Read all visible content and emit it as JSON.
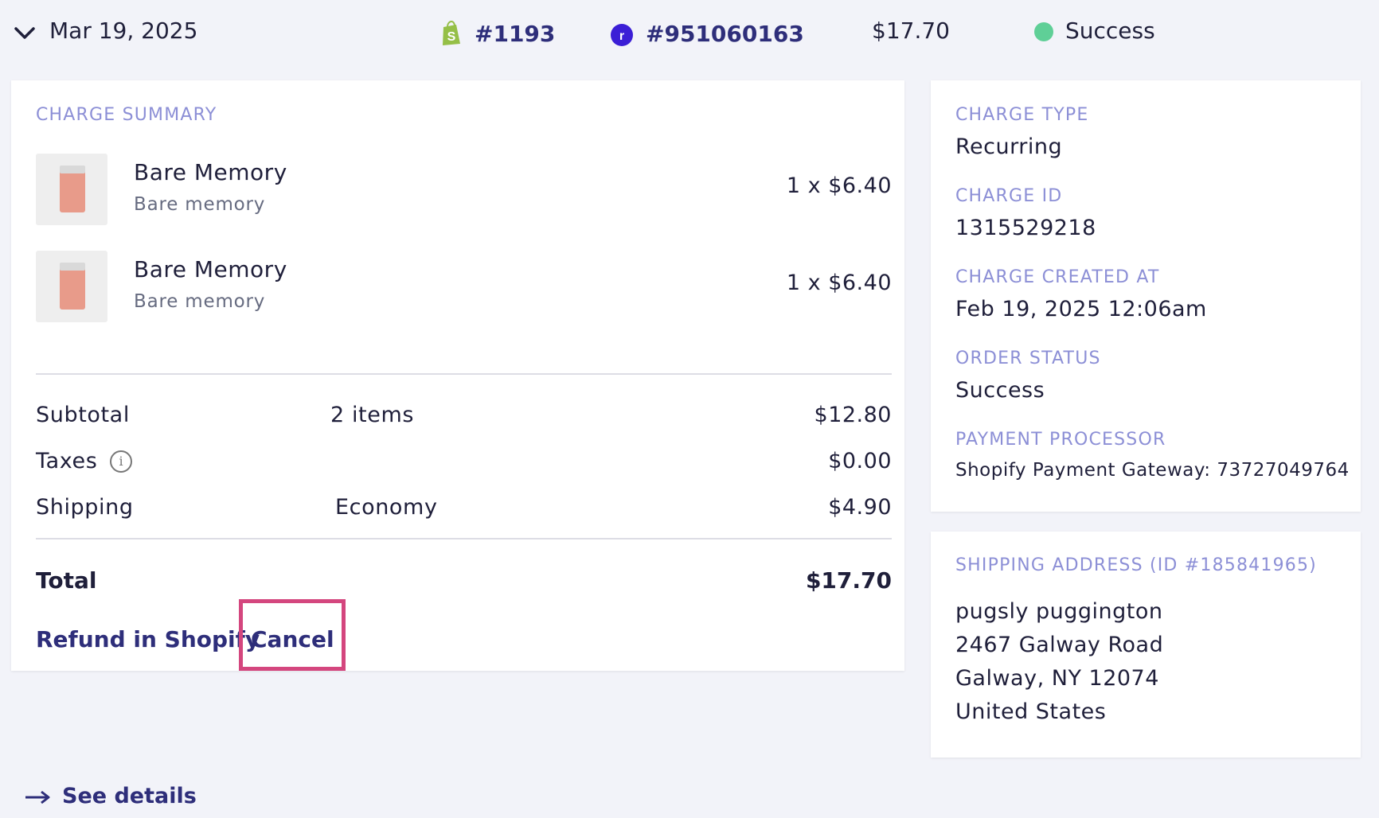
{
  "header": {
    "date": "Mar 19, 2025",
    "shopify_order": "#1193",
    "recharge_order": "#951060163",
    "amount": "$17.70",
    "status": "Success",
    "status_color": "#5fcf97"
  },
  "charge_summary": {
    "title": "CHARGE SUMMARY",
    "items": [
      {
        "title": "Bare Memory",
        "subtitle": "Bare memory",
        "qty_price": "1 x $6.40"
      },
      {
        "title": "Bare Memory",
        "subtitle": "Bare memory",
        "qty_price": "1 x $6.40"
      }
    ],
    "subtotal": {
      "label": "Subtotal",
      "mid": "2 items",
      "value": "$12.80"
    },
    "taxes": {
      "label": "Taxes",
      "value": "$0.00"
    },
    "shipping": {
      "label": "Shipping",
      "mid": "Economy",
      "value": "$4.90"
    },
    "total": {
      "label": "Total",
      "value": "$17.70"
    },
    "refund_link": "Refund in Shopify",
    "cancel_link": "Cancel"
  },
  "charge_info": {
    "charge_type_label": "CHARGE TYPE",
    "charge_type": "Recurring",
    "charge_id_label": "CHARGE ID",
    "charge_id": "1315529218",
    "created_label": "CHARGE CREATED AT",
    "created": "Feb 19, 2025 12:06am",
    "order_status_label": "ORDER STATUS",
    "order_status": "Success",
    "processor_label": "PAYMENT PROCESSOR",
    "processor": "Shopify Payment Gateway: 73727049764"
  },
  "shipping_address": {
    "label": "SHIPPING ADDRESS (ID #185841965)",
    "name": "pugsly puggington",
    "street": "2467 Galway Road",
    "city": "Galway, NY 12074",
    "country": "United States"
  },
  "footer": {
    "see_details": "See details"
  },
  "colors": {
    "accent": "#2e2e7a",
    "label": "#8c8fd6",
    "highlight": "#d4467e"
  }
}
